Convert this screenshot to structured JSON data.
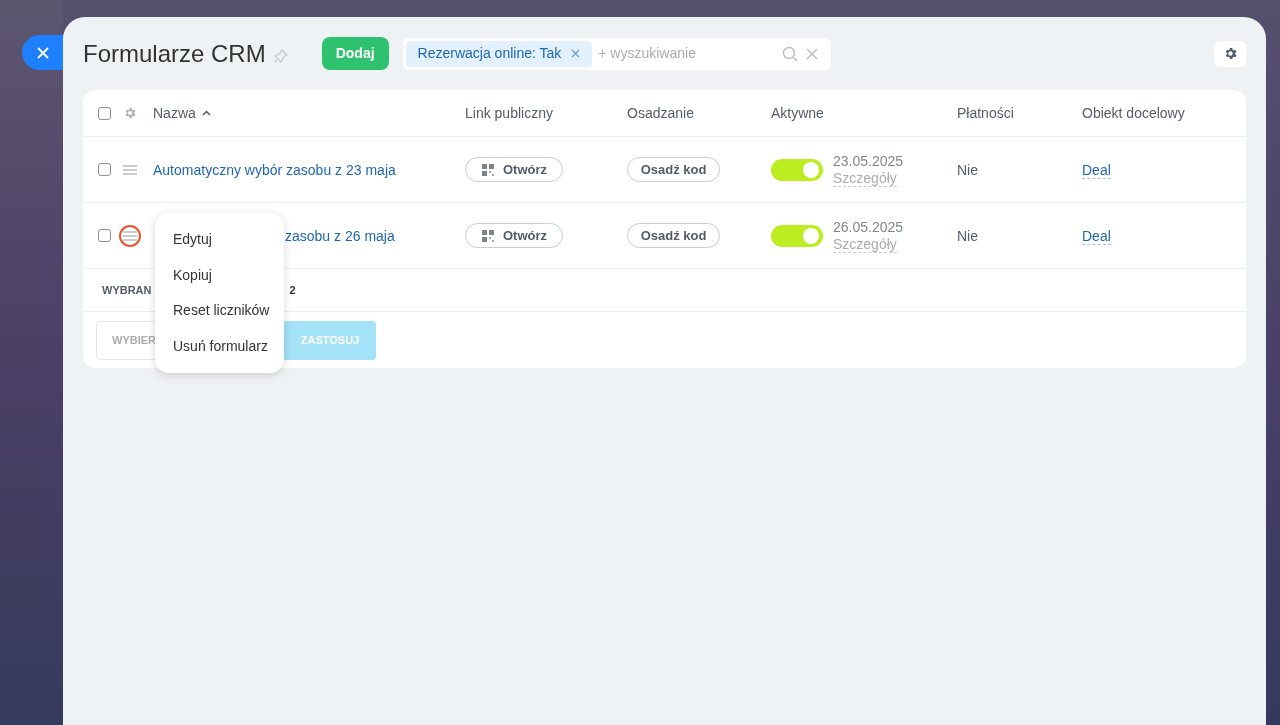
{
  "header": {
    "title": "Formularze CRM",
    "add_button": "Dodaj",
    "filter_chip": "Rezerwacja online: Tak",
    "search": {
      "placeholder": "+ wyszukiwanie"
    }
  },
  "table": {
    "select_all_checked": false,
    "columns": [
      "Nazwa",
      "Link publiczny",
      "Osadzanie",
      "Aktywne",
      "Płatności",
      "Obiekt docelowy"
    ],
    "rows": [
      {
        "name": "Automatyczny wybór zasobu z 23 maja",
        "link": "Otwórz",
        "embed": "Osadź kod",
        "active": true,
        "date": "23.05.2025",
        "details": "Szczegóły",
        "payments": "Nie",
        "target": "Deal",
        "checked": false,
        "highlighted": false,
        "menu_open": false
      },
      {
        "name": "zasobu z 26 maja",
        "link": "Otwórz",
        "embed": "Osadź kod",
        "active": true,
        "date": "26.05.2025",
        "details": "Szczegóły",
        "payments": "Nie",
        "target": "Deal",
        "checked": false,
        "highlighted": true,
        "menu_open": true
      }
    ],
    "footer": {
      "selected_label": "WYBRAN",
      "selected_count": "2",
      "action_select": "WYBIER",
      "apply_button": "ZASTOSUJ"
    }
  },
  "context_menu": {
    "items": [
      "Edytuj",
      "Kopiuj",
      "Reset liczników",
      "Usuń formularz"
    ]
  }
}
